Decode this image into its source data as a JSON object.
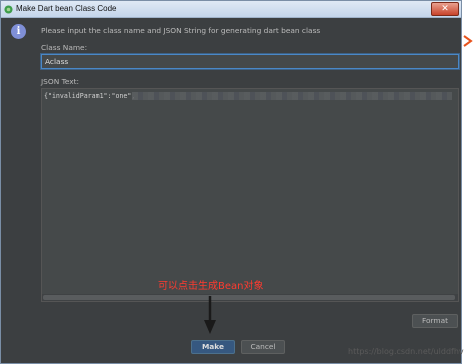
{
  "window": {
    "title": "Make Dart bean Class Code",
    "close_label": "✕"
  },
  "dialog": {
    "info_text": "Please input the class name and JSON String for generating dart bean class",
    "class_name_label": "Class Name:",
    "class_name_value": "Aclass",
    "json_label": "JSON Text:",
    "json_value": "{\"invalidParam1\":\"one\","
  },
  "buttons": {
    "format": "Format",
    "make": "Make",
    "cancel": "Cancel"
  },
  "annotation": {
    "text": "可以点击生成Bean对象",
    "color": "#ff3b2f"
  },
  "watermark": "https://blog.csdn.net/ulddfhv",
  "icons": {
    "app": "android-studio-icon",
    "info": "info-icon",
    "arrow": "red-arrow-down",
    "side": "orange-chevron-icon"
  },
  "colors": {
    "dialog_bg": "#3c3f41",
    "primary_button": "#365880",
    "annotation": "#ff3b2f"
  }
}
